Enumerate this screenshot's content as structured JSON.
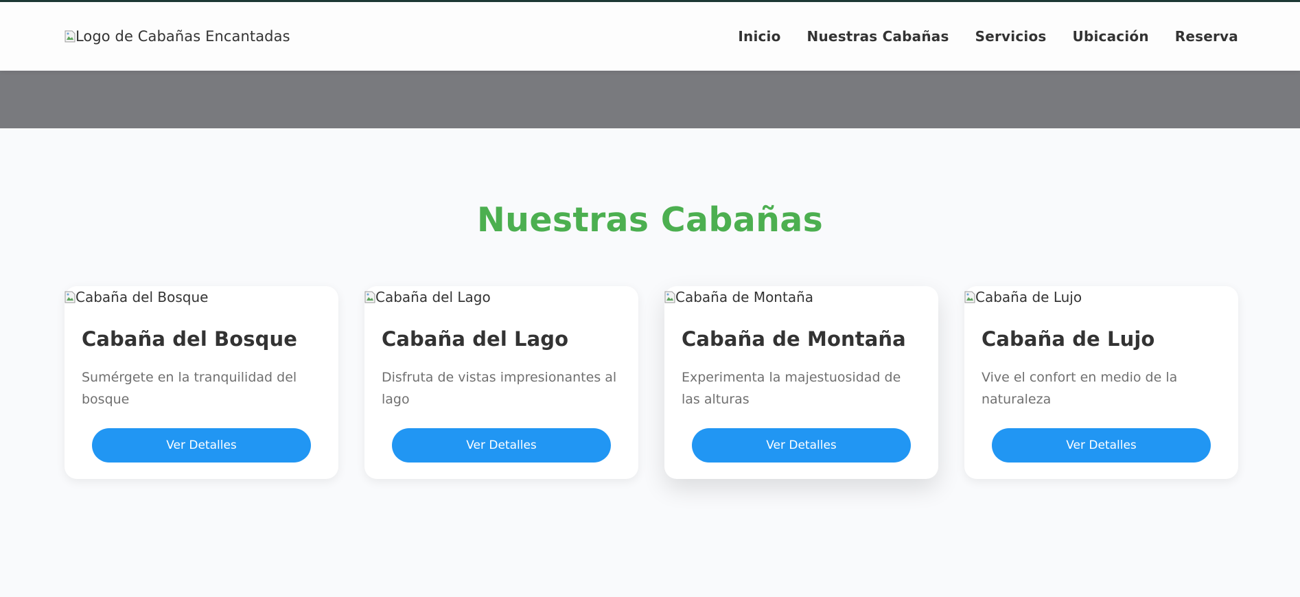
{
  "header": {
    "logo_alt": "Logo de Cabañas Encantadas",
    "nav": [
      {
        "label": "Inicio"
      },
      {
        "label": "Nuestras Cabañas"
      },
      {
        "label": "Servicios"
      },
      {
        "label": "Ubicación"
      },
      {
        "label": "Reserva"
      }
    ]
  },
  "main": {
    "section_title": "Nuestras Cabañas",
    "cards": [
      {
        "image_alt": "Cabaña del Bosque",
        "title": "Cabaña del Bosque",
        "description": "Sumérgete en la tranquilidad del bosque",
        "button_label": "Ver Detalles"
      },
      {
        "image_alt": "Cabaña del Lago",
        "title": "Cabaña del Lago",
        "description": "Disfruta de vistas impresionantes al lago",
        "button_label": "Ver Detalles"
      },
      {
        "image_alt": "Cabaña de Montaña",
        "title": "Cabaña de Montaña",
        "description": "Experimenta la majestuosidad de las alturas",
        "button_label": "Ver Detalles"
      },
      {
        "image_alt": "Cabaña de Lujo",
        "title": "Cabaña de Lujo",
        "description": "Vive el confort en medio de la naturaleza",
        "button_label": "Ver Detalles"
      }
    ]
  },
  "colors": {
    "accent_green": "#4caf50",
    "button_blue": "#2196f3",
    "hero_gray": "#797a7e",
    "header_top_border": "#1e3a36"
  },
  "icons": {
    "broken_image": "broken-image-icon"
  }
}
